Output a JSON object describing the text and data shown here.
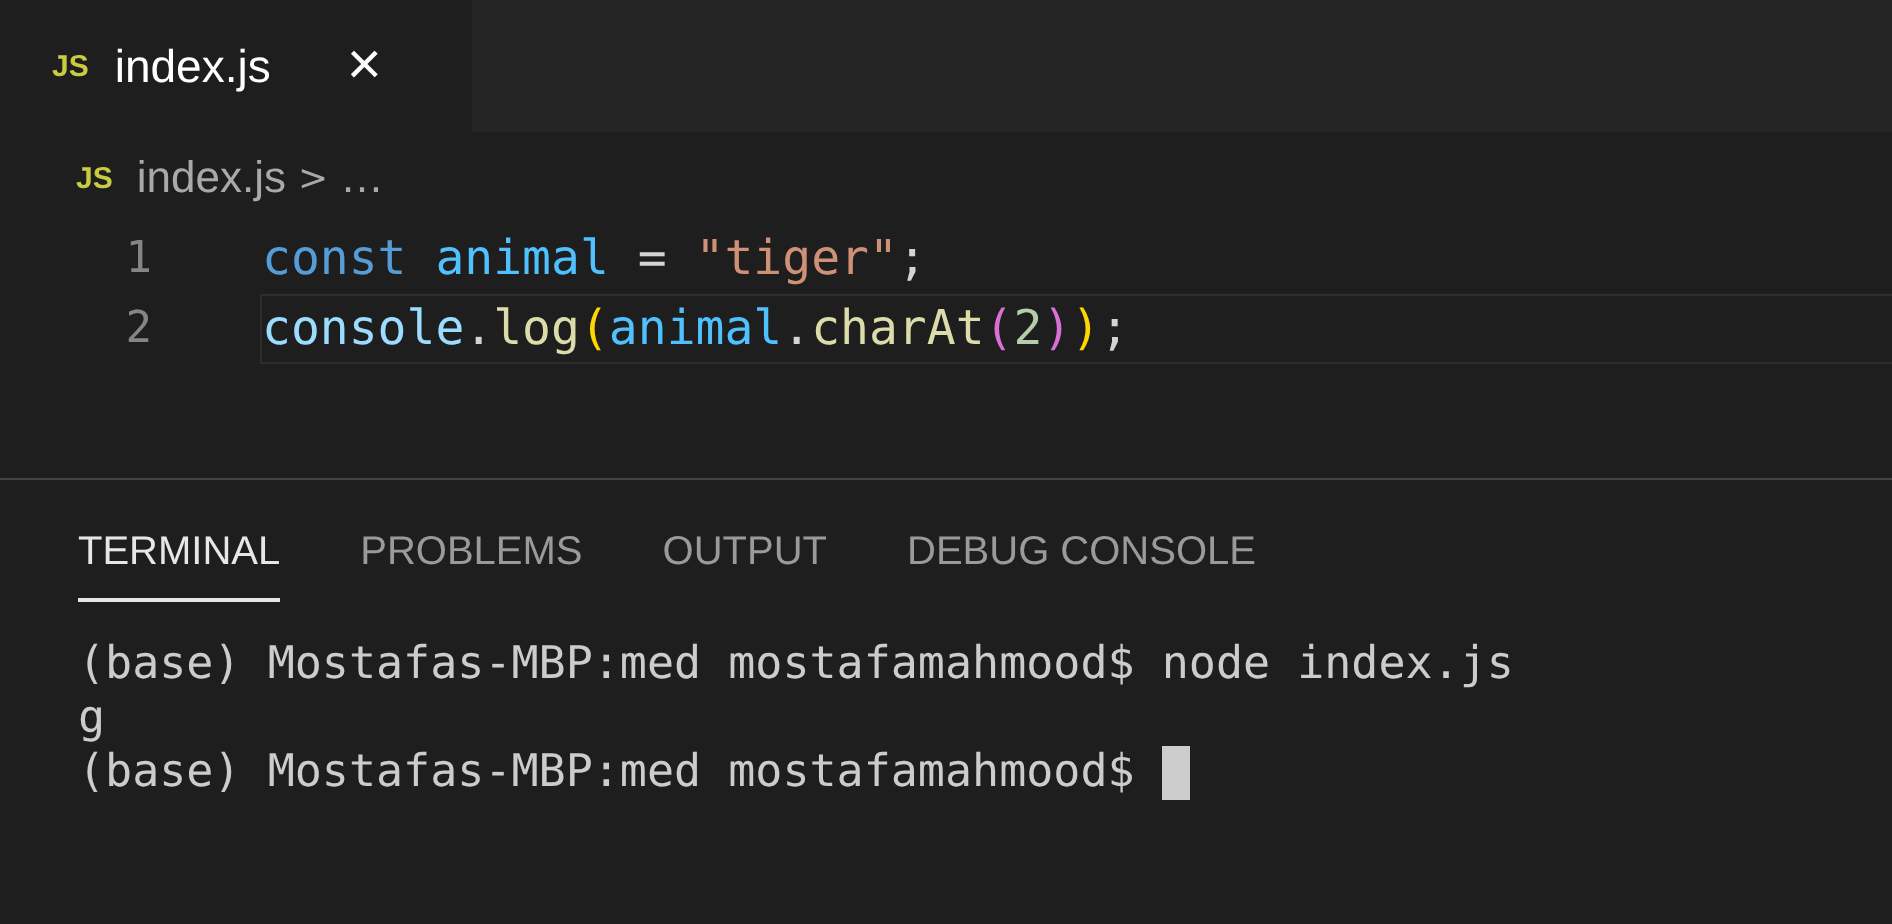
{
  "tabs": [
    {
      "icon_text": "JS",
      "label": "index.js",
      "close": "×",
      "selected": true
    }
  ],
  "breadcrumb": {
    "icon_text": "JS",
    "file": "index.js",
    "separator": ">",
    "more": "…"
  },
  "code_lines": [
    {
      "number": "1",
      "current": false,
      "tokens": [
        {
          "kind": "keyword",
          "text": "const "
        },
        {
          "kind": "variable",
          "text": "animal"
        },
        {
          "kind": "plain",
          "text": " = "
        },
        {
          "kind": "string",
          "text": "\"tiger\""
        },
        {
          "kind": "plain",
          "text": ";"
        }
      ]
    },
    {
      "number": "2",
      "current": true,
      "tokens": [
        {
          "kind": "object",
          "text": "console"
        },
        {
          "kind": "plain",
          "text": "."
        },
        {
          "kind": "function",
          "text": "log"
        },
        {
          "kind": "bracket1",
          "text": "("
        },
        {
          "kind": "variable",
          "text": "animal"
        },
        {
          "kind": "plain",
          "text": "."
        },
        {
          "kind": "function",
          "text": "charAt"
        },
        {
          "kind": "bracket2",
          "text": "("
        },
        {
          "kind": "number",
          "text": "2"
        },
        {
          "kind": "bracket2",
          "text": ")"
        },
        {
          "kind": "bracket1",
          "text": ")"
        },
        {
          "kind": "plain",
          "text": ";"
        }
      ]
    }
  ],
  "panel_tabs": [
    {
      "label": "TERMINAL",
      "selected": true
    },
    {
      "label": "PROBLEMS",
      "selected": false
    },
    {
      "label": "OUTPUT",
      "selected": false
    },
    {
      "label": "DEBUG CONSOLE",
      "selected": false
    }
  ],
  "terminal": {
    "lines": [
      "(base) Mostafas-MBP:med mostafamahmood$ node index.js",
      "g",
      "(base) Mostafas-MBP:med mostafamahmood$ "
    ],
    "cursor": true
  }
}
